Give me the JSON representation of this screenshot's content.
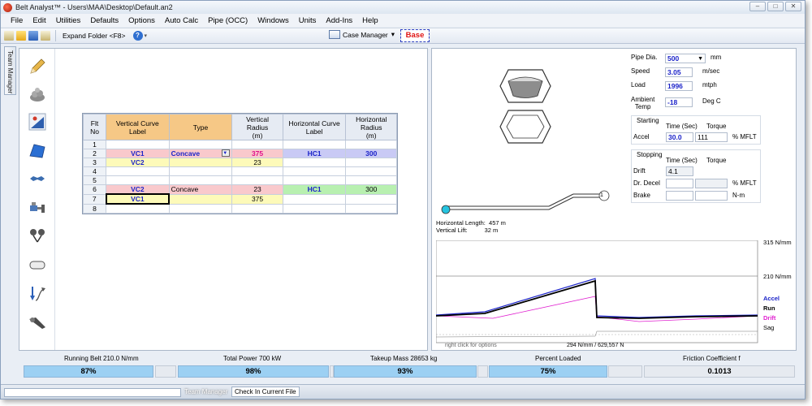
{
  "window": {
    "title": "Belt Analyst™ - Users\\MAA\\Desktop\\Default.an2",
    "min": "–",
    "max": "□",
    "close": "✕"
  },
  "menu": [
    "File",
    "Edit",
    "Utilities",
    "Defaults",
    "Options",
    "Auto Calc",
    "Pipe (OCC)",
    "Windows",
    "Units",
    "Add-Ins",
    "Help"
  ],
  "toolbar": {
    "expand_folder": "Expand Folder <F8>",
    "help": "?",
    "case_manager": "Case Manager",
    "case_caret": "▾",
    "base": "Base"
  },
  "side_tab": "Team Manager",
  "grid": {
    "headers": [
      "Flt\nNo",
      "Vertical Curve\nLabel",
      "Type",
      "Vertical\nRadius\n(m)",
      "Horizontal Curve\nLabel",
      "Horizontal\nRadius\n(m)"
    ],
    "rows": [
      {
        "no": "1",
        "vlabel": "",
        "type": "",
        "vradius": "",
        "hlabel": "",
        "hradius": ""
      },
      {
        "no": "2",
        "vlabel": "VC1",
        "type": "Concave",
        "vradius": "375",
        "hlabel": "HC1",
        "hradius": "300"
      },
      {
        "no": "3",
        "vlabel": "VC2",
        "type": "",
        "vradius": "23",
        "hlabel": "",
        "hradius": ""
      },
      {
        "no": "4",
        "vlabel": "",
        "type": "",
        "vradius": "",
        "hlabel": "",
        "hradius": ""
      },
      {
        "no": "5",
        "vlabel": "",
        "type": "",
        "vradius": "",
        "hlabel": "",
        "hradius": ""
      },
      {
        "no": "6",
        "vlabel": "VC2",
        "type": "Concave",
        "vradius": "23",
        "hlabel": "HC1",
        "hradius": "300"
      },
      {
        "no": "7",
        "vlabel": "VC1",
        "type": "",
        "vradius": "375",
        "hlabel": "",
        "hradius": ""
      },
      {
        "no": "8",
        "vlabel": "",
        "type": "",
        "vradius": "",
        "hlabel": "",
        "hradius": ""
      }
    ]
  },
  "params": {
    "pipe_dia": {
      "label": "Pipe Dia.",
      "value": "500",
      "unit": "mm"
    },
    "speed": {
      "label": "Speed",
      "value": "3.05",
      "unit": "m/sec"
    },
    "load": {
      "label": "Load",
      "value": "1996",
      "unit": "mtph"
    },
    "ambient": {
      "label": "Ambient\nTemp",
      "value": "-18",
      "unit": "Deg C"
    },
    "starting": {
      "title": "Starting",
      "time_hdr": "Time (Sec)",
      "torque_hdr": "Torque",
      "accel_label": "Accel",
      "accel_time": "30.0",
      "accel_torque": "111",
      "unit": "% MFLT"
    },
    "stopping": {
      "title": "Stopping",
      "time_hdr": "Time (Sec)",
      "torque_hdr": "Torque",
      "drift_label": "Drift",
      "drift_time": "4.1",
      "decel_label": "Dr. Decel",
      "decel_unit": "% MFLT",
      "brake_label": "Brake",
      "brake_unit": "N-m"
    }
  },
  "profile": {
    "marker": "1",
    "horizontal_length": "Horizontal Length:  457 m",
    "vertical_lift": "Vertical Lift:          32 m"
  },
  "tension_chart": {
    "ticks": [
      "315 N/mm",
      "210 N/mm"
    ],
    "legend": [
      {
        "name": "Accel",
        "color": "#1b23c9"
      },
      {
        "name": "Run",
        "color": "#000000"
      },
      {
        "name": "Drift",
        "color": "#e020d0"
      },
      {
        "name": "Sag",
        "color": "#000000"
      }
    ],
    "hint": "right click for options",
    "footer": "294 N/mm  /  629,557 N"
  },
  "stats": {
    "running_belt": "Running Belt 210.0 N/mm",
    "total_power": "Total Power 700 kW",
    "takeup_mass": "Takeup Mass 28653  kg",
    "percent_loaded": "Percent Loaded",
    "friction": "Friction Coefficient f",
    "bars": [
      "87%",
      "98%",
      "93%",
      "75%",
      "0.1013"
    ]
  },
  "statusbar": {
    "team_manager": "Team Manager",
    "check_in": "Check In Current File"
  },
  "chart_data": {
    "type": "line",
    "title": "",
    "xlabel": "",
    "ylabel": "",
    "yticks": [
      "315 N/mm",
      "210 N/mm"
    ],
    "series": [
      {
        "name": "Accel",
        "values": []
      },
      {
        "name": "Run",
        "values": []
      },
      {
        "name": "Drift",
        "values": []
      },
      {
        "name": "Sag",
        "values": []
      }
    ]
  }
}
